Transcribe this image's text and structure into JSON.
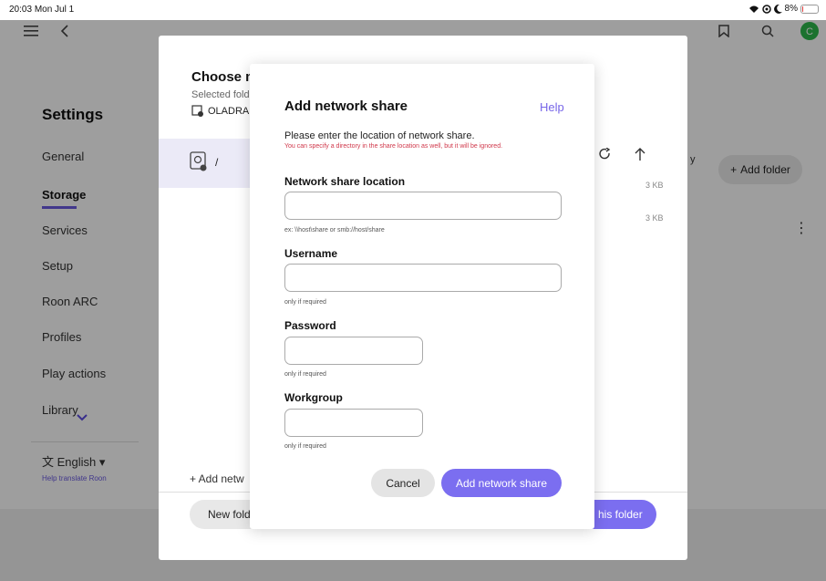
{
  "statusbar": {
    "time": "20:03",
    "date": "Mon Jul 1",
    "battery": "8%",
    "battery_level": 0.08
  },
  "sidebar": {
    "title": "Settings",
    "items": [
      {
        "label": "General",
        "active": false
      },
      {
        "label": "Storage",
        "active": true
      },
      {
        "label": "Services",
        "active": false
      },
      {
        "label": "Setup",
        "active": false
      },
      {
        "label": "Roon ARC",
        "active": false
      },
      {
        "label": "Profiles",
        "active": false
      },
      {
        "label": "Play actions",
        "active": false
      },
      {
        "label": "Library",
        "active": false
      }
    ],
    "language": "English",
    "help_translate": "Help translate Roon"
  },
  "main": {
    "add_folder": "Add folder",
    "stray_text": "y"
  },
  "folder_dialog": {
    "title": "Choose mu",
    "subtitle": "Selected fold",
    "drive": "OLADRA",
    "path": "/",
    "sizes": [
      "3 KB",
      "3 KB"
    ],
    "add_network": "+ Add netw",
    "new_folder": "New fold",
    "use_folder": "his folder"
  },
  "share_dialog": {
    "title": "Add network share",
    "help": "Help",
    "prompt": "Please enter the location of network share.",
    "warning": "You can specify a directory in the share location as well, but it will be ignored.",
    "location_label": "Network share location",
    "location_value": "",
    "location_hint": "ex: \\\\host\\share or smb://host/share",
    "username_label": "Username",
    "username_value": "",
    "username_hint": "only if required",
    "password_label": "Password",
    "password_value": "",
    "password_hint": "only if required",
    "workgroup_label": "Workgroup",
    "workgroup_value": "",
    "workgroup_hint": "only if required",
    "cancel": "Cancel",
    "submit": "Add network share"
  },
  "colors": {
    "accent": "#7b6ef0",
    "warning": "#d0374a",
    "avatar": "#2db84b"
  },
  "icons": [
    "menu-icon",
    "back-icon",
    "bookmark-icon",
    "search-icon",
    "avatar-icon",
    "refresh-icon",
    "up-arrow-icon",
    "disk-icon",
    "translate-icon",
    "chevron-down-icon",
    "kebab-icon",
    "wifi-icon",
    "battery-icon"
  ]
}
